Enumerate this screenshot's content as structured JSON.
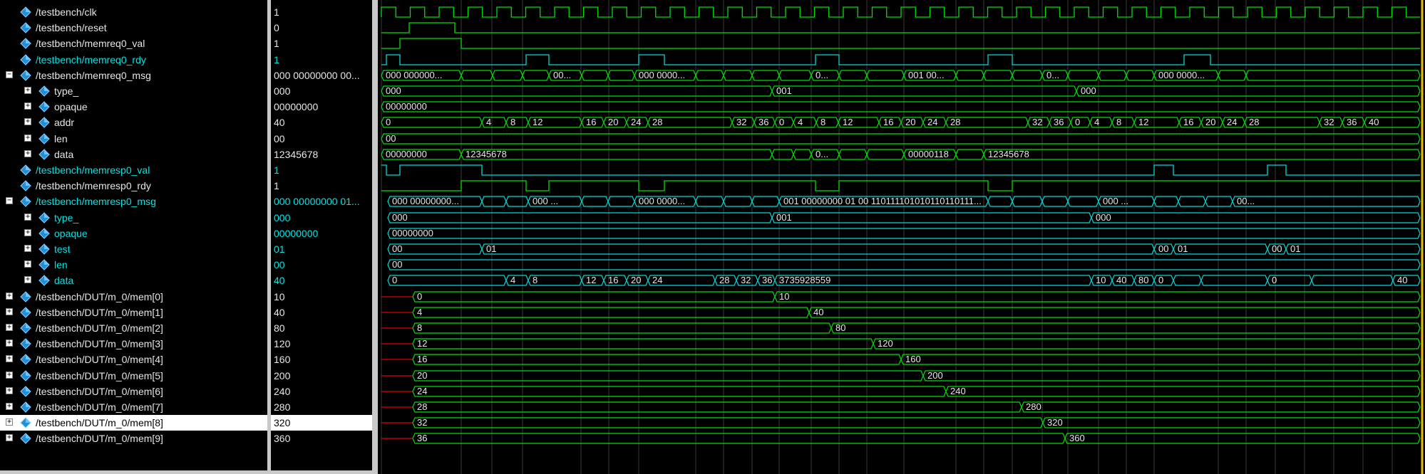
{
  "signals": [
    {
      "name": "/testbench/clk",
      "value": "1",
      "level": 0,
      "color": "white",
      "expander": "none",
      "icon": "diamond-icon"
    },
    {
      "name": "/testbench/reset",
      "value": "0",
      "level": 0,
      "color": "white",
      "expander": "none",
      "icon": "diamond-icon"
    },
    {
      "name": "/testbench/memreq0_val",
      "value": "1",
      "level": 0,
      "color": "white",
      "expander": "none",
      "icon": "diamond-icon"
    },
    {
      "name": "/testbench/memreq0_rdy",
      "value": "1",
      "level": 0,
      "color": "cyan",
      "expander": "none",
      "icon": "diamond-icon"
    },
    {
      "name": "/testbench/memreq0_msg",
      "value": "000 00000000 00...",
      "level": 0,
      "color": "white",
      "expander": "minus",
      "icon": "diamond-icon"
    },
    {
      "name": "type_",
      "value": "000",
      "level": 1,
      "color": "white",
      "expander": "plus",
      "icon": "diamond-icon"
    },
    {
      "name": "opaque",
      "value": "00000000",
      "level": 1,
      "color": "white",
      "expander": "plus",
      "icon": "diamond-icon"
    },
    {
      "name": "addr",
      "value": "40",
      "level": 1,
      "color": "white",
      "expander": "plus",
      "icon": "diamond-icon"
    },
    {
      "name": "len",
      "value": "00",
      "level": 1,
      "color": "white",
      "expander": "plus",
      "icon": "diamond-icon"
    },
    {
      "name": "data",
      "value": "12345678",
      "level": 1,
      "color": "white",
      "expander": "plus",
      "icon": "diamond-icon"
    },
    {
      "name": "/testbench/memresp0_val",
      "value": "1",
      "level": 0,
      "color": "cyan",
      "expander": "none",
      "icon": "diamond-icon"
    },
    {
      "name": "/testbench/memresp0_rdy",
      "value": "1",
      "level": 0,
      "color": "white",
      "expander": "none",
      "icon": "diamond-icon"
    },
    {
      "name": "/testbench/memresp0_msg",
      "value": "000 00000000 01...",
      "level": 0,
      "color": "cyan",
      "expander": "minus",
      "icon": "diamond-icon"
    },
    {
      "name": "type_",
      "value": "000",
      "level": 1,
      "color": "cyan",
      "expander": "plus",
      "icon": "diamond-icon"
    },
    {
      "name": "opaque",
      "value": "00000000",
      "level": 1,
      "color": "cyan",
      "expander": "plus",
      "icon": "diamond-icon"
    },
    {
      "name": "test",
      "value": "01",
      "level": 1,
      "color": "cyan",
      "expander": "plus",
      "icon": "diamond-icon"
    },
    {
      "name": "len",
      "value": "00",
      "level": 1,
      "color": "cyan",
      "expander": "plus",
      "icon": "diamond-icon"
    },
    {
      "name": "data",
      "value": "40",
      "level": 1,
      "color": "cyan",
      "expander": "plus",
      "icon": "diamond-icon"
    },
    {
      "name": "/testbench/DUT/m_0/mem[0]",
      "value": "10",
      "level": 0,
      "color": "white",
      "expander": "plus",
      "icon": "diamond-icon"
    },
    {
      "name": "/testbench/DUT/m_0/mem[1]",
      "value": "40",
      "level": 0,
      "color": "white",
      "expander": "plus",
      "icon": "diamond-icon"
    },
    {
      "name": "/testbench/DUT/m_0/mem[2]",
      "value": "80",
      "level": 0,
      "color": "white",
      "expander": "plus",
      "icon": "diamond-icon"
    },
    {
      "name": "/testbench/DUT/m_0/mem[3]",
      "value": "120",
      "level": 0,
      "color": "white",
      "expander": "plus",
      "icon": "diamond-icon"
    },
    {
      "name": "/testbench/DUT/m_0/mem[4]",
      "value": "160",
      "level": 0,
      "color": "white",
      "expander": "plus",
      "icon": "diamond-icon"
    },
    {
      "name": "/testbench/DUT/m_0/mem[5]",
      "value": "200",
      "level": 0,
      "color": "white",
      "expander": "plus",
      "icon": "diamond-icon"
    },
    {
      "name": "/testbench/DUT/m_0/mem[6]",
      "value": "240",
      "level": 0,
      "color": "white",
      "expander": "plus",
      "icon": "diamond-icon"
    },
    {
      "name": "/testbench/DUT/m_0/mem[7]",
      "value": "280",
      "level": 0,
      "color": "white",
      "expander": "plus",
      "icon": "diamond-icon"
    },
    {
      "name": "/testbench/DUT/m_0/mem[8]",
      "value": "320",
      "level": 0,
      "color": "white",
      "expander": "plus",
      "icon": "diamond-icon",
      "selected": true
    },
    {
      "name": "/testbench/DUT/m_0/mem[9]",
      "value": "360",
      "level": 0,
      "color": "white",
      "expander": "plus",
      "icon": "diamond-icon"
    }
  ],
  "colors": {
    "green": "#00e000",
    "cyan": "#00d8d8",
    "red": "#e00000",
    "grid": "#3a3a3a",
    "cursor": "#e8c000",
    "text": "#e6e6e6"
  },
  "waves": {
    "clk": {
      "type": "clock",
      "start": 5,
      "period": 40.5,
      "count": 36
    },
    "reset": {
      "type": "bit",
      "color": "green",
      "init": 0,
      "toggles": [
        44,
        108
      ]
    },
    "memreq0_val": {
      "type": "bit",
      "color": "green",
      "init": 0,
      "toggles": [
        31,
        117
      ]
    },
    "memreq0_rdy": {
      "type": "bit",
      "color": "cyan",
      "init": 0,
      "toggles": [
        12,
        31,
        208,
        240,
        366,
        402,
        614,
        647,
        856,
        890,
        1131,
        1168
      ]
    },
    "memreq0_msg": {
      "type": "bus",
      "color": "green",
      "segments": [
        [
          5,
          "000 000000..."
        ],
        [
          117,
          ""
        ],
        [
          161,
          ""
        ],
        [
          203,
          ""
        ],
        [
          240,
          "000 ..."
        ],
        [
          286,
          ""
        ],
        [
          323,
          ""
        ],
        [
          360,
          "000 0000..."
        ],
        [
          446,
          ""
        ],
        [
          485,
          ""
        ],
        [
          525,
          ""
        ],
        [
          563,
          ""
        ],
        [
          608,
          "001 ..."
        ],
        [
          647,
          ""
        ],
        [
          686,
          ""
        ],
        [
          738,
          "001 0000..."
        ],
        [
          811,
          ""
        ],
        [
          850,
          ""
        ],
        [
          890,
          ""
        ],
        [
          932,
          "000 ..."
        ],
        [
          968,
          ""
        ],
        [
          1011,
          ""
        ],
        [
          1050,
          ""
        ],
        [
          1089,
          "000 0000..."
        ],
        [
          1179,
          ""
        ],
        [
          1218,
          ""
        ]
      ]
    },
    "type_req": {
      "type": "bus",
      "color": "green",
      "segments": [
        [
          5,
          "000"
        ],
        [
          553,
          "001"
        ],
        [
          980,
          "000"
        ]
      ]
    },
    "opaque_req": {
      "type": "bus",
      "color": "green",
      "segments": [
        [
          5,
          "00000000"
        ]
      ]
    },
    "addr": {
      "type": "bus",
      "color": "green",
      "segments": [
        [
          5,
          "0"
        ],
        [
          146,
          "4"
        ],
        [
          180,
          "8"
        ],
        [
          211,
          "12"
        ],
        [
          286,
          "16"
        ],
        [
          317,
          "20"
        ],
        [
          349,
          "24"
        ],
        [
          379,
          "28"
        ],
        [
          497,
          "32"
        ],
        [
          528,
          "36"
        ],
        [
          557,
          "0"
        ],
        [
          583,
          "4"
        ],
        [
          615,
          "8"
        ],
        [
          646,
          "12"
        ],
        [
          703,
          "16"
        ],
        [
          734,
          "20"
        ],
        [
          765,
          "24"
        ],
        [
          797,
          "28"
        ],
        [
          912,
          "32"
        ],
        [
          942,
          "36"
        ],
        [
          972,
          "0"
        ],
        [
          999,
          "4"
        ],
        [
          1030,
          "8"
        ],
        [
          1061,
          "12"
        ],
        [
          1124,
          "16"
        ],
        [
          1155,
          "20"
        ],
        [
          1185,
          "24"
        ],
        [
          1216,
          "28"
        ],
        [
          1321,
          "32"
        ],
        [
          1353,
          "36"
        ],
        [
          1384,
          "40"
        ]
      ]
    },
    "len_req": {
      "type": "bus",
      "color": "green",
      "segments": [
        [
          5,
          "00"
        ]
      ]
    },
    "data_req": {
      "type": "bus",
      "color": "green",
      "segments": [
        [
          5,
          "00000000"
        ],
        [
          117,
          "12345678"
        ],
        [
          553,
          ""
        ],
        [
          583,
          ""
        ],
        [
          608,
          "0000..."
        ],
        [
          647,
          ""
        ],
        [
          686,
          ""
        ],
        [
          738,
          "00000118"
        ],
        [
          811,
          ""
        ],
        [
          850,
          "12345678"
        ]
      ]
    },
    "memresp0_val": {
      "type": "bit",
      "color": "cyan",
      "init": 1,
      "toggles": [
        12,
        31,
        146,
        1089,
        1116,
        1248,
        1274
      ]
    },
    "memresp0_rdy": {
      "type": "bit",
      "color": "green",
      "init": 0,
      "toggles": [
        117,
        208,
        240,
        366,
        402,
        614,
        647,
        856,
        890
      ]
    },
    "memresp0_msg": {
      "type": "bus",
      "color": "cyan",
      "segments": [
        [
          14,
          "000 00000000..."
        ],
        [
          146,
          ""
        ],
        [
          180,
          ""
        ],
        [
          211,
          "000 ..."
        ],
        [
          286,
          ""
        ],
        [
          323,
          ""
        ],
        [
          360,
          "000 0000..."
        ],
        [
          446,
          ""
        ],
        [
          485,
          ""
        ],
        [
          525,
          ""
        ],
        [
          563,
          "001 00000000 01 00 11011110101011011011111011101..."
        ],
        [
          856,
          ""
        ],
        [
          890,
          ""
        ],
        [
          932,
          ""
        ],
        [
          968,
          ""
        ],
        [
          1011,
          "000 ..."
        ],
        [
          1089,
          ""
        ],
        [
          1123,
          ""
        ],
        [
          1161,
          ""
        ],
        [
          1199,
          "00..."
        ]
      ]
    },
    "type_resp": {
      "type": "bus",
      "color": "cyan",
      "segments": [
        [
          14,
          "000"
        ],
        [
          553,
          "001"
        ],
        [
          1001,
          "000"
        ]
      ]
    },
    "opaque_resp": {
      "type": "bus",
      "color": "cyan",
      "segments": [
        [
          14,
          "00000000"
        ]
      ]
    },
    "test": {
      "type": "bus",
      "color": "cyan",
      "segments": [
        [
          14,
          "00"
        ],
        [
          146,
          "01"
        ],
        [
          1089,
          "00"
        ],
        [
          1116,
          "01"
        ],
        [
          1248,
          "00"
        ],
        [
          1274,
          "01"
        ]
      ]
    },
    "len_resp": {
      "type": "bus",
      "color": "cyan",
      "segments": [
        [
          14,
          "00"
        ]
      ]
    },
    "data_resp": {
      "type": "bus",
      "color": "cyan",
      "segments": [
        [
          14,
          "0"
        ],
        [
          180,
          "4"
        ],
        [
          211,
          "8"
        ],
        [
          286,
          "12"
        ],
        [
          317,
          "16"
        ],
        [
          349,
          "20"
        ],
        [
          379,
          "24"
        ],
        [
          473,
          "28"
        ],
        [
          503,
          "32"
        ],
        [
          533,
          "36"
        ],
        [
          557,
          "3735928559"
        ],
        [
          1001,
          "10"
        ],
        [
          1030,
          "40"
        ],
        [
          1061,
          "80"
        ],
        [
          1089,
          "0"
        ],
        [
          1116,
          ""
        ],
        [
          1155,
          ""
        ],
        [
          1248,
          "0"
        ],
        [
          1310,
          ""
        ],
        [
          1424,
          "40"
        ]
      ]
    },
    "mem0": {
      "type": "membus",
      "start": 49,
      "segments": [
        [
          49,
          "0"
        ],
        [
          557,
          "10"
        ]
      ]
    },
    "mem1": {
      "type": "membus",
      "start": 49,
      "segments": [
        [
          49,
          "4"
        ],
        [
          605,
          "40"
        ]
      ]
    },
    "mem2": {
      "type": "membus",
      "start": 49,
      "segments": [
        [
          49,
          "8"
        ],
        [
          636,
          "80"
        ]
      ]
    },
    "mem3": {
      "type": "membus",
      "start": 49,
      "segments": [
        [
          49,
          "12"
        ],
        [
          695,
          "120"
        ]
      ]
    },
    "mem4": {
      "type": "membus",
      "start": 49,
      "segments": [
        [
          49,
          "16"
        ],
        [
          734,
          "160"
        ]
      ]
    },
    "mem5": {
      "type": "membus",
      "start": 49,
      "segments": [
        [
          49,
          "20"
        ],
        [
          765,
          "200"
        ]
      ]
    },
    "mem6": {
      "type": "membus",
      "start": 49,
      "segments": [
        [
          49,
          "24"
        ],
        [
          797,
          "240"
        ]
      ]
    },
    "mem7": {
      "type": "membus",
      "start": 49,
      "segments": [
        [
          49,
          "28"
        ],
        [
          903,
          "280"
        ]
      ]
    },
    "mem8": {
      "type": "membus",
      "start": 49,
      "segments": [
        [
          49,
          "32"
        ],
        [
          933,
          "320"
        ]
      ]
    },
    "mem9": {
      "type": "membus",
      "start": 49,
      "segments": [
        [
          49,
          "36"
        ],
        [
          964,
          "360"
        ]
      ]
    }
  },
  "wave_order": [
    "clk",
    "reset",
    "memreq0_val",
    "memreq0_rdy",
    "memreq0_msg",
    "type_req",
    "opaque_req",
    "addr",
    "len_req",
    "data_req",
    "memresp0_val",
    "memresp0_rdy",
    "memresp0_msg",
    "type_resp",
    "opaque_resp",
    "test",
    "len_resp",
    "data_resp",
    "mem0",
    "mem1",
    "mem2",
    "mem3",
    "mem4",
    "mem5",
    "mem6",
    "mem7",
    "mem8",
    "mem9"
  ]
}
